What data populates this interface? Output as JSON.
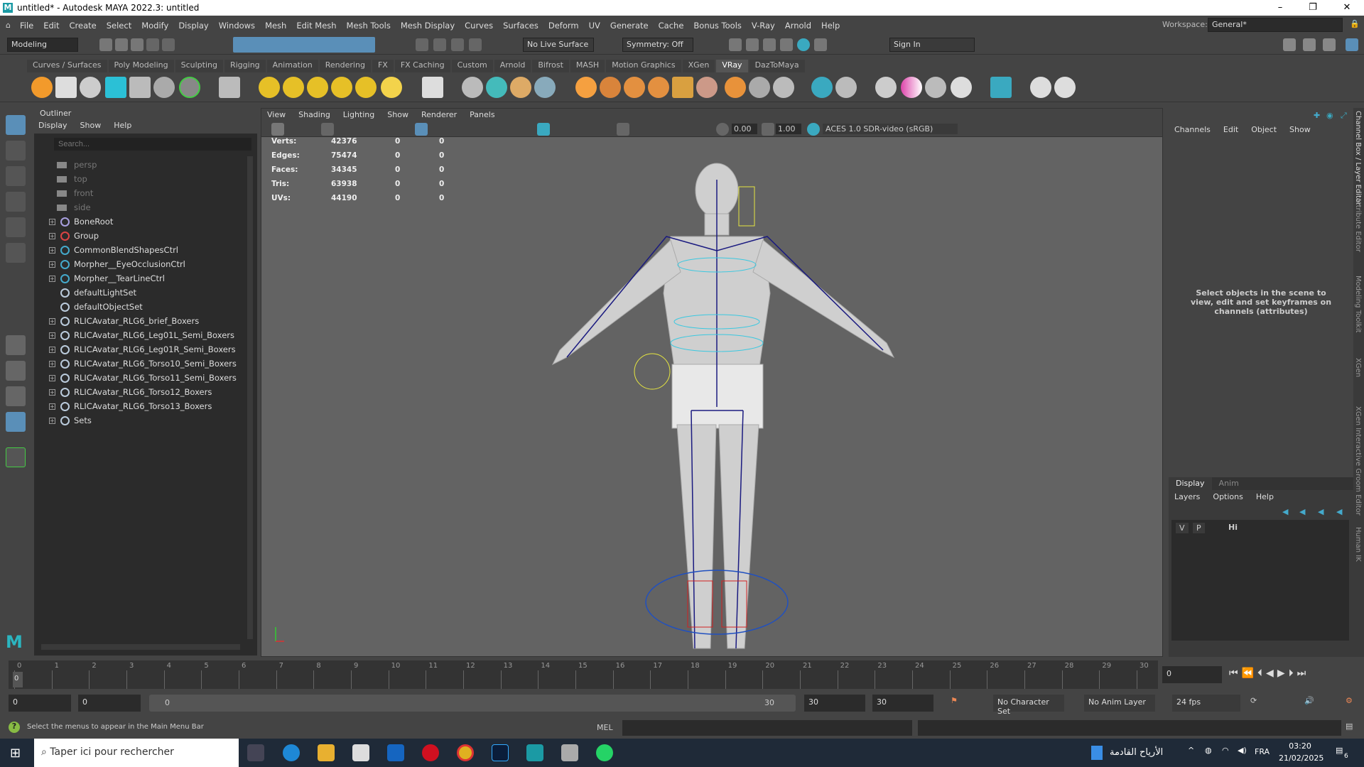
{
  "window": {
    "title": "untitled* - Autodesk MAYA 2022.3: untitled",
    "minimize": "–",
    "maximize": "❐",
    "close": "✕"
  },
  "menubar": {
    "items": [
      "File",
      "Edit",
      "Create",
      "Select",
      "Modify",
      "Display",
      "Windows",
      "Mesh",
      "Edit Mesh",
      "Mesh Tools",
      "Mesh Display",
      "Curves",
      "Surfaces",
      "Deform",
      "UV",
      "Generate",
      "Cache",
      "Bonus Tools",
      "V-Ray",
      "Arnold",
      "Help"
    ],
    "workspace_label": "Workspace:",
    "workspace_value": "General*"
  },
  "statusline": {
    "mode": "Modeling",
    "live_surface": "No Live Surface",
    "symmetry": "Symmetry: Off",
    "sign_in": "Sign In"
  },
  "shelf": {
    "tabs": [
      "Curves / Surfaces",
      "Poly Modeling",
      "Sculpting",
      "Rigging",
      "Animation",
      "Rendering",
      "FX",
      "FX Caching",
      "Custom",
      "Arnold",
      "Bifrost",
      "MASH",
      "Motion Graphics",
      "XGen",
      "VRay",
      "DazToMaya"
    ],
    "active": "VRay"
  },
  "outliner": {
    "title": "Outliner",
    "menus": [
      "Display",
      "Show",
      "Help"
    ],
    "search_placeholder": "Search...",
    "items": [
      {
        "label": "persp",
        "type": "camera",
        "expand": false
      },
      {
        "label": "top",
        "type": "camera",
        "expand": false
      },
      {
        "label": "front",
        "type": "camera",
        "expand": false
      },
      {
        "label": "side",
        "type": "camera",
        "expand": false
      },
      {
        "label": "BoneRoot",
        "type": "joint",
        "expand": true
      },
      {
        "label": "Group",
        "type": "group",
        "expand": true
      },
      {
        "label": "CommonBlendShapesCtrl",
        "type": "curve",
        "expand": true
      },
      {
        "label": "Morpher__EyeOcclusionCtrl",
        "type": "curve",
        "expand": true
      },
      {
        "label": "Morpher__TearLineCtrl",
        "type": "curve",
        "expand": true
      },
      {
        "label": "defaultLightSet",
        "type": "set",
        "expand": false
      },
      {
        "label": "defaultObjectSet",
        "type": "set",
        "expand": false
      },
      {
        "label": "RLICAvatar_RLG6_brief_Boxers",
        "type": "set",
        "expand": true
      },
      {
        "label": "RLICAvatar_RLG6_Leg01L_Semi_Boxers",
        "type": "set",
        "expand": true
      },
      {
        "label": "RLICAvatar_RLG6_Leg01R_Semi_Boxers",
        "type": "set",
        "expand": true
      },
      {
        "label": "RLICAvatar_RLG6_Torso10_Semi_Boxers",
        "type": "set",
        "expand": true
      },
      {
        "label": "RLICAvatar_RLG6_Torso11_Semi_Boxers",
        "type": "set",
        "expand": true
      },
      {
        "label": "RLICAvatar_RLG6_Torso12_Boxers",
        "type": "set",
        "expand": true
      },
      {
        "label": "RLICAvatar_RLG6_Torso13_Boxers",
        "type": "set",
        "expand": true
      },
      {
        "label": "Sets",
        "type": "set",
        "expand": true
      }
    ]
  },
  "viewport": {
    "menus": [
      "View",
      "Shading",
      "Lighting",
      "Show",
      "Renderer",
      "Panels"
    ],
    "exposure": "0.00",
    "gamma": "1.00",
    "color_space": "ACES 1.0 SDR-video (sRGB)",
    "stats": [
      {
        "label": "Verts:",
        "v": "42376",
        "a": "0",
        "b": "0"
      },
      {
        "label": "Edges:",
        "v": "75474",
        "a": "0",
        "b": "0"
      },
      {
        "label": "Faces:",
        "v": "34345",
        "a": "0",
        "b": "0"
      },
      {
        "label": "Tris:",
        "v": "63938",
        "a": "0",
        "b": "0"
      },
      {
        "label": "UVs:",
        "v": "44190",
        "a": "0",
        "b": "0"
      }
    ]
  },
  "channelbox": {
    "menus": [
      "Channels",
      "Edit",
      "Object",
      "Show"
    ],
    "hint": "Select objects in the scene to view, edit and set keyframes on channels (attributes)"
  },
  "layers": {
    "tabs": [
      "Display",
      "Anim"
    ],
    "menus": [
      "Layers",
      "Options",
      "Help"
    ],
    "v": "V",
    "p": "P",
    "hi": "Hi"
  },
  "side_tabs": [
    "Channel Box / Layer Editor",
    "Attribute Editor",
    "Modeling Toolkit",
    "XGen",
    "XGen Interactive Groom Editor",
    "Human IK"
  ],
  "timeline": {
    "frames": [
      0,
      1,
      2,
      3,
      4,
      5,
      6,
      7,
      8,
      9,
      10,
      11,
      12,
      13,
      14,
      15,
      16,
      17,
      18,
      19,
      20,
      21,
      22,
      23,
      24,
      25,
      26,
      27,
      28,
      29,
      30
    ],
    "current": "0",
    "current_field": "0"
  },
  "range": {
    "start": "0",
    "anim_start": "0",
    "slider_start": "0",
    "slider_end": "30",
    "end": "30",
    "anim_end": "30",
    "character_set": "No Character Set",
    "anim_layer": "No Anim Layer",
    "fps": "24 fps"
  },
  "cmdline": {
    "help": "Select the menus to appear in the Main Menu Bar",
    "mel": "MEL"
  },
  "taskbar": {
    "search_placeholder": "Taper ici pour rechercher",
    "weather": "الأرياح القادمة",
    "lang": "FRA",
    "time": "03:20",
    "date": "21/02/2025",
    "notifications": "6"
  }
}
